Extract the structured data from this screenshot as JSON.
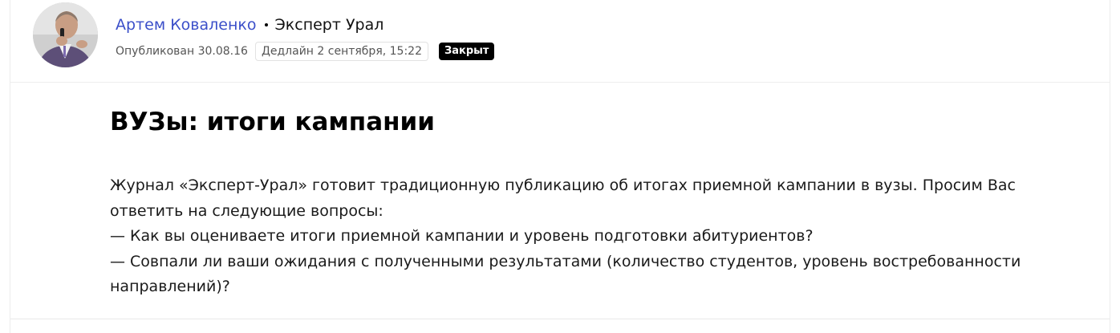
{
  "author": {
    "name": "Артем Коваленко",
    "publication": "Эксперт Урал",
    "published": "Опубликован 30.08.16",
    "deadline": "Дедлайн 2 сентября, 15:22",
    "status": "Закрыт"
  },
  "article": {
    "title": "ВУЗы: итоги кампании",
    "paragraphs": [
      "Журнал «Эксперт-Урал» готовит традиционную публикацию об итогах приемной кампании в вузы. Просим Вас ответить на следующие вопросы:",
      "— Как вы оцениваете итоги приемной кампании и уровень подготовки абитуриентов?",
      "— Совпали ли ваши ожидания с полученными результатами (количество студентов, уровень востребованности направлений)?"
    ]
  },
  "colors": {
    "author_link": "#3b4fc9",
    "badge_bg": "#000000"
  }
}
